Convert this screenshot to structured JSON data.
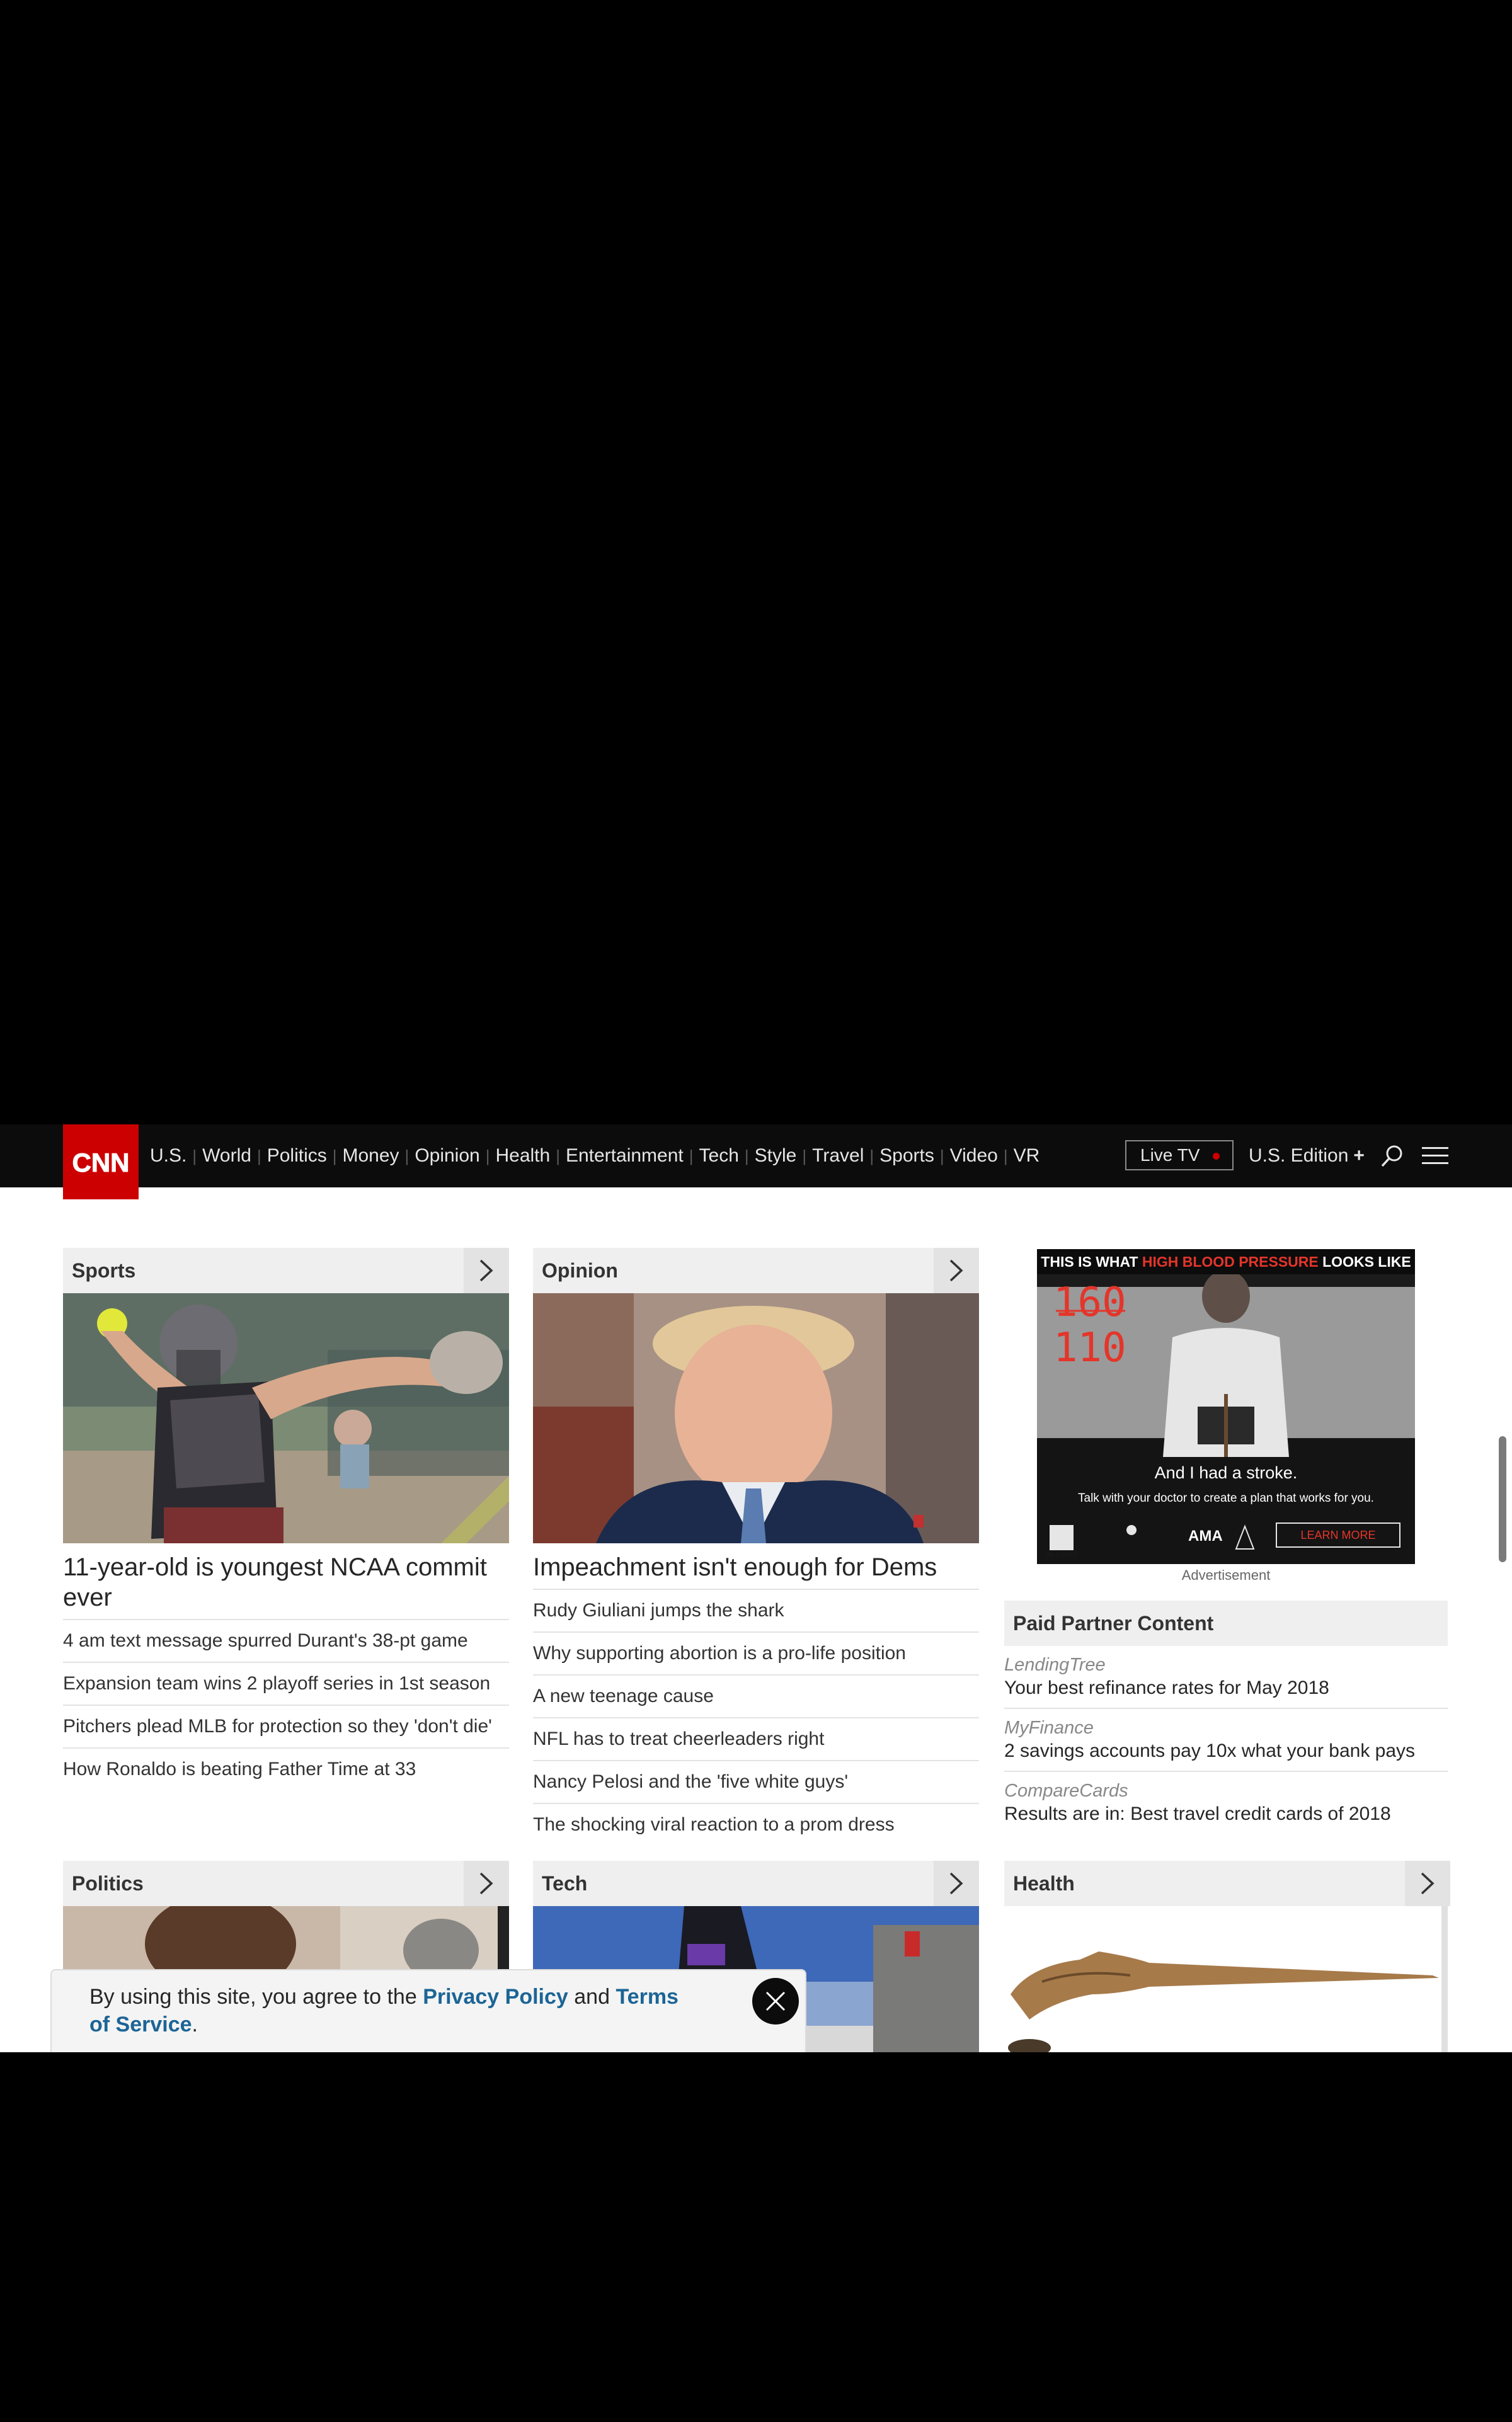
{
  "nav": {
    "logo": "CNN",
    "links": [
      "U.S.",
      "World",
      "Politics",
      "Money",
      "Opinion",
      "Health",
      "Entertainment",
      "Tech",
      "Style",
      "Travel",
      "Sports",
      "Video",
      "VR"
    ],
    "live_tv": "Live TV",
    "edition": "U.S. Edition",
    "edition_plus": "+"
  },
  "sports": {
    "title": "Sports",
    "headline": "11-year-old is youngest NCAA commit ever",
    "items": [
      "4 am text message spurred Durant's 38-pt game",
      "Expansion team wins 2 playoff series in 1st season",
      "Pitchers plead MLB for protection so they 'don't die'",
      "How Ronaldo is beating Father Time at 33"
    ]
  },
  "opinion": {
    "title": "Opinion",
    "headline": "Impeachment isn't enough for Dems",
    "items": [
      "Rudy Giuliani jumps the shark",
      "Why supporting abortion is a pro-life position",
      "A new teenage cause",
      "NFL has to treat cheerleaders right",
      "Nancy Pelosi and the 'five white guys'",
      "The shocking viral reaction to a prom dress"
    ]
  },
  "ad": {
    "headline_pre": "THIS IS WHAT ",
    "headline_highlight": "HIGH BLOOD PRESSURE",
    "headline_post": " LOOKS LIKE",
    "systolic": "160",
    "diastolic": "110",
    "stroke_text": "And I had a stroke.",
    "subtext": "Talk with your doctor to create a plan that works for you.",
    "cta": "LEARN MORE",
    "logo_ad_council": "Ad Council",
    "logo_ama": "AMA",
    "label": "Advertisement",
    "highlight_color": "#e4352a"
  },
  "partner": {
    "title": "Paid Partner Content",
    "items": [
      {
        "brand": "LendingTree",
        "title": "Your best refinance rates for May 2018"
      },
      {
        "brand": "MyFinance",
        "title": "2 savings accounts pay 10x what your bank pays"
      },
      {
        "brand": "CompareCards",
        "title": "Results are in: Best travel credit cards of 2018"
      }
    ]
  },
  "row2": {
    "politics": "Politics",
    "tech": "Tech",
    "health": "Health"
  },
  "consent": {
    "prefix": "By using this site, you agree to the ",
    "privacy": "Privacy Policy",
    "middle": " and ",
    "terms": "Terms of Service",
    "suffix": "."
  },
  "colors": {
    "brand_red": "#cc0000",
    "link_blue": "#1c6596"
  }
}
